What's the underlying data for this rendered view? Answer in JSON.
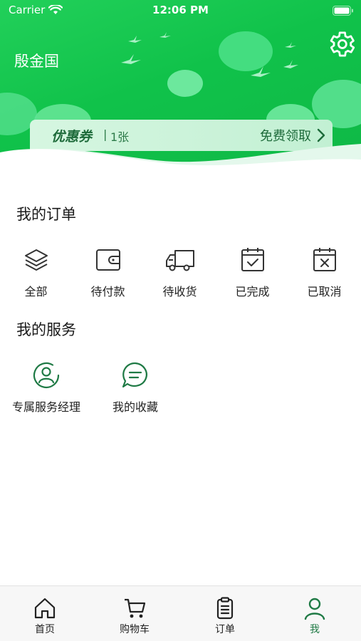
{
  "status_bar": {
    "carrier": "Carrier",
    "time": "12:06 PM"
  },
  "profile": {
    "username": "殷金国"
  },
  "coupon": {
    "title": "优惠券",
    "separator": "|",
    "count": "1张",
    "claim_label": "免费领取"
  },
  "orders": {
    "title": "我的订单",
    "items": [
      {
        "label": "全部",
        "icon": "layers-icon"
      },
      {
        "label": "待付款",
        "icon": "wallet-icon"
      },
      {
        "label": "待收货",
        "icon": "truck-icon"
      },
      {
        "label": "已完成",
        "icon": "calendar-check-icon"
      },
      {
        "label": "已取消",
        "icon": "calendar-x-icon"
      }
    ]
  },
  "services": {
    "title": "我的服务",
    "items": [
      {
        "label": "专属服务经理",
        "icon": "manager-icon"
      },
      {
        "label": "我的收藏",
        "icon": "chat-bubble-icon"
      }
    ]
  },
  "tabbar": {
    "active": "我",
    "items": [
      {
        "label": "首页",
        "icon": "home-icon"
      },
      {
        "label": "购物车",
        "icon": "cart-icon"
      },
      {
        "label": "订单",
        "icon": "clipboard-icon"
      },
      {
        "label": "我",
        "icon": "person-icon"
      }
    ]
  },
  "colors": {
    "header_green": "#10c24a",
    "accent_green": "#1f7a45",
    "coupon_text": "#1e6b3b"
  }
}
